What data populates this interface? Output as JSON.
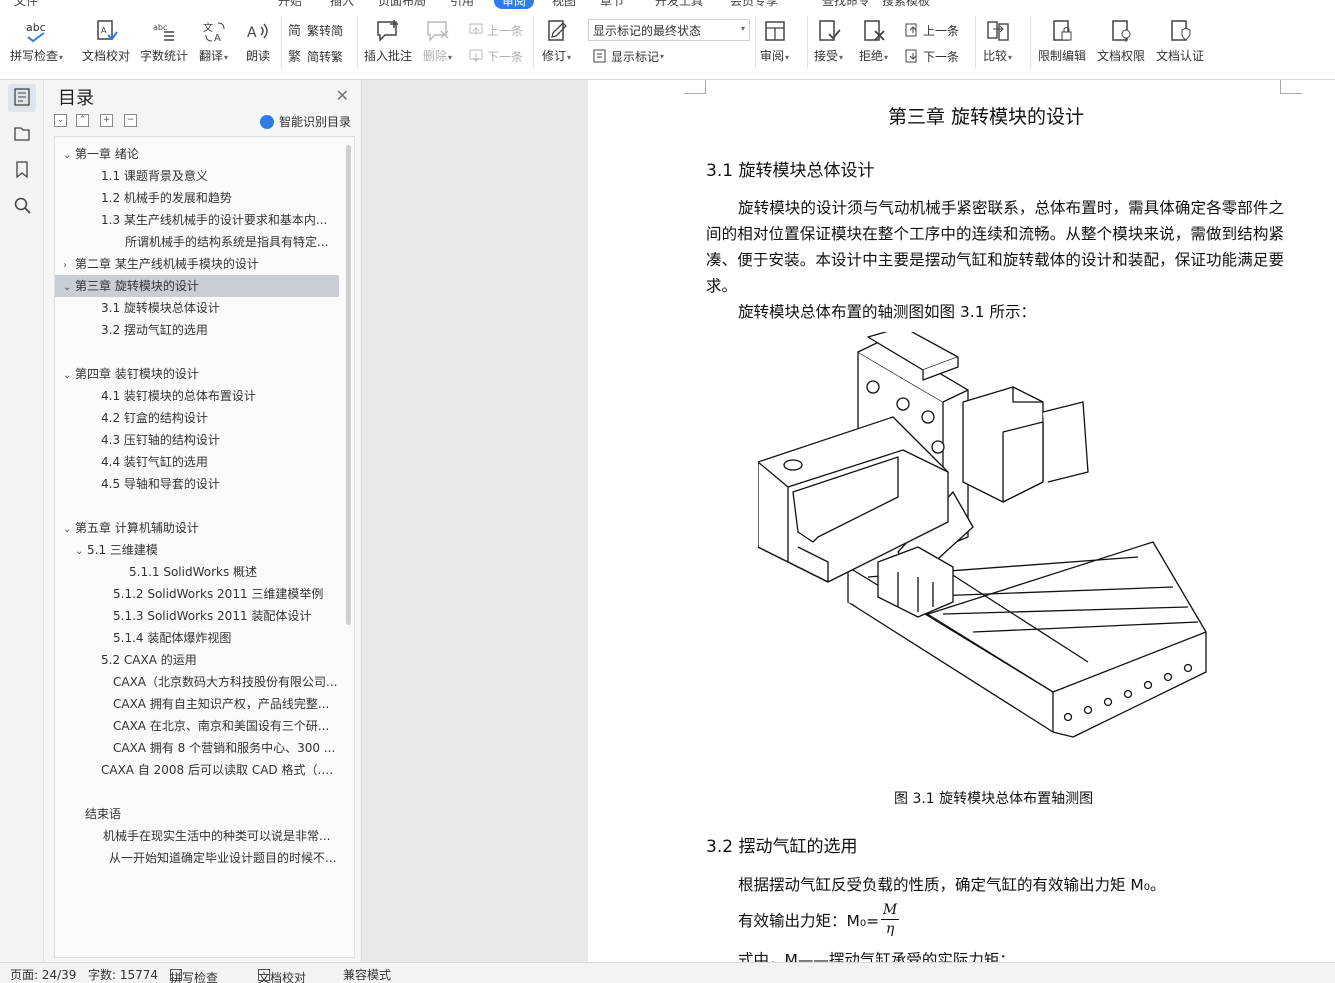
{
  "ribbon": {
    "tabs": [
      "文件",
      "开始",
      "插入",
      "页面布局",
      "引用",
      "审阅",
      "视图",
      "章节",
      "开发工具",
      "会员专享",
      "查找命令",
      "搜索模板"
    ],
    "active_tab": "审阅",
    "spell_check": "拼写检查",
    "doc_proof": "文档校对",
    "word_count": "字数统计",
    "translate": "翻译",
    "read_aloud": "朗读",
    "trad_to_simp": "繁转简",
    "simp_to_trad": "简转繁",
    "insert_comment": "插入批注",
    "delete": "删除",
    "prev_comment": "上一条",
    "next_comment": "下一条",
    "revise": "修订",
    "markup_state": "显示标记的最终状态",
    "show_markup": "显示标记",
    "review": "审阅",
    "accept": "接受",
    "reject": "拒绝",
    "prev_change": "上一条",
    "next_change": "下一条",
    "compare": "比较",
    "restrict_edit": "限制编辑",
    "doc_rights": "文档权限",
    "doc_cert": "文档认证"
  },
  "nav": {
    "title": "目录",
    "smart_toc": "智能识别目录",
    "items": [
      {
        "text": "第一章  绪论",
        "arrow": "v"
      },
      {
        "text": "1.1  课题背景及意义",
        "arrow": ""
      },
      {
        "text": "1.2  机械手的发展和趋势",
        "arrow": ""
      },
      {
        "text": "1.3  某生产线机械手的设计要求和基本内...",
        "arrow": ""
      },
      {
        "text": "所谓机械手的结构系统是指具有特定...",
        "arrow": ""
      },
      {
        "text": "第二章    某生产线机械手模块的设计",
        "arrow": ">"
      },
      {
        "text": "第三章  旋转模块的设计",
        "arrow": "v"
      },
      {
        "text": "3.1 旋转模块总体设计",
        "arrow": ""
      },
      {
        "text": "3.2 摆动气缸的选用",
        "arrow": ""
      },
      {
        "text": "",
        "arrow": ""
      },
      {
        "text": "第四章  装钉模块的设计",
        "arrow": "v"
      },
      {
        "text": "4.1  装钉模块的总体布置设计",
        "arrow": ""
      },
      {
        "text": "4.2 钉盒的结构设计",
        "arrow": ""
      },
      {
        "text": "4.3 压钉轴的结构设计",
        "arrow": ""
      },
      {
        "text": "4.4 装钉气缸的选用",
        "arrow": ""
      },
      {
        "text": "4.5 导轴和导套的设计",
        "arrow": ""
      },
      {
        "text": "",
        "arrow": ""
      },
      {
        "text": "第五章  计算机辅助设计",
        "arrow": "v"
      },
      {
        "text": "5.1  三维建模",
        "arrow": "v"
      },
      {
        "text": "5.1.1 SolidWorks 概述",
        "arrow": ""
      },
      {
        "text": "5.1.2 SolidWorks 2011 三维建模举例",
        "arrow": ""
      },
      {
        "text": "5.1.3 SolidWorks      2011 装配体设计",
        "arrow": ""
      },
      {
        "text": "5.1.4 装配体爆炸视图",
        "arrow": ""
      },
      {
        "text": "5.2 CAXA 的运用",
        "arrow": ""
      },
      {
        "text": "CAXA（北京数码大方科技股份有限公司...",
        "arrow": ""
      },
      {
        "text": "CAXA 拥有自主知识产权，产品线完整...",
        "arrow": ""
      },
      {
        "text": "CAXA 在北京、南京和美国设有三个研...",
        "arrow": ""
      },
      {
        "text": "CAXA 拥有 8 个营销和服务中心、300 ...",
        "arrow": ""
      },
      {
        "text": "CAXA 自 2008 后可以读取 CAD 格式（.d...",
        "arrow": ""
      },
      {
        "text": "",
        "arrow": ""
      },
      {
        "text": "结束语",
        "arrow": ""
      },
      {
        "text": "机械手在现实生活中的种类可以说是非常...",
        "arrow": ""
      },
      {
        "text": "从一开始知道确定毕业设计题目的时候不...",
        "arrow": ""
      }
    ]
  },
  "document": {
    "chapter_title": "第三章  旋转模块的设计",
    "section1": "3.1 旋转模块总体设计",
    "para1": "旋转模块的设计须与气动机械手紧密联系，总体布置时，需具体确定各零部件之间的相对位置保证模块在整个工序中的连续和流畅。从整个模块来说，需做到结构紧凑、便于安装。本设计中主要是摆动气缸和旋转载体的设计和装配，保证功能满足要求。",
    "para2": "旋转模块总体布置的轴测图如图 3.1 所示：",
    "figure_caption": "图 3.1  旋转模块总体布置轴测图",
    "section2": "3.2 摆动气缸的选用",
    "para3": "根据摆动气缸反受负载的性质，确定气缸的有效输出力矩 M₀。",
    "formula_label": "有效输出力矩：M₀=",
    "formula_num": "M",
    "formula_den": "η",
    "para4": "式中，M——摆动气缸承受的实际力矩；"
  },
  "status": {
    "page": "页面: 24/39",
    "words": "字数: 15774",
    "spell": "拼写检查",
    "proof": "文档校对",
    "compat": "兼容模式"
  }
}
